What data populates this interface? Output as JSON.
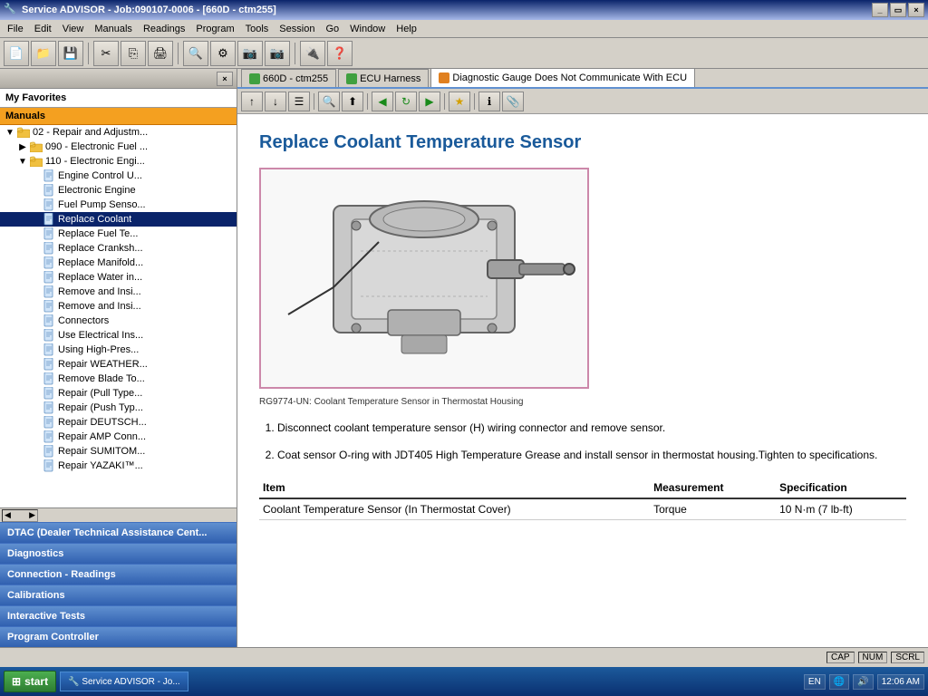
{
  "window": {
    "title": "Service ADVISOR - Job:090107-0006 - [660D - ctm255]",
    "icon": "🔧"
  },
  "menu": {
    "items": [
      "File",
      "Edit",
      "View",
      "Manuals",
      "Readings",
      "Program",
      "Tools",
      "Session",
      "Go",
      "Window",
      "Help"
    ]
  },
  "tabs": [
    {
      "label": "660D - ctm255",
      "color": "green",
      "active": false
    },
    {
      "label": "ECU Harness",
      "color": "green",
      "active": false
    },
    {
      "label": "Diagnostic Gauge Does Not Communicate With ECU",
      "color": "orange",
      "active": true
    }
  ],
  "left_panel": {
    "close_btn": "×",
    "my_favorites": "My Favorites",
    "manuals_label": "Manuals",
    "tree": [
      {
        "level": 1,
        "type": "folder",
        "label": "02 - Repair and Adjustm...",
        "expanded": true
      },
      {
        "level": 2,
        "type": "folder",
        "label": "090 - Electronic Fuel ...",
        "expanded": false
      },
      {
        "level": 2,
        "type": "folder",
        "label": "110 - Electronic Engi...",
        "expanded": true
      },
      {
        "level": 3,
        "type": "doc",
        "label": "Engine Control U..."
      },
      {
        "level": 3,
        "type": "doc",
        "label": "Electronic Engine"
      },
      {
        "level": 3,
        "type": "doc",
        "label": "Fuel Pump Senso..."
      },
      {
        "level": 3,
        "type": "doc",
        "label": "Replace Coolant",
        "selected": true
      },
      {
        "level": 3,
        "type": "doc",
        "label": "Replace Fuel Te..."
      },
      {
        "level": 3,
        "type": "doc",
        "label": "Replace Cranksh..."
      },
      {
        "level": 3,
        "type": "doc",
        "label": "Replace Manifold..."
      },
      {
        "level": 3,
        "type": "doc",
        "label": "Replace Water in..."
      },
      {
        "level": 3,
        "type": "doc",
        "label": "Remove and Insi..."
      },
      {
        "level": 3,
        "type": "doc",
        "label": "Remove and Insi..."
      },
      {
        "level": 3,
        "type": "doc",
        "label": "Connectors"
      },
      {
        "level": 3,
        "type": "doc",
        "label": "Use Electrical Ins..."
      },
      {
        "level": 3,
        "type": "doc",
        "label": "Using High-Pres..."
      },
      {
        "level": 3,
        "type": "doc",
        "label": "Repair WEATHER..."
      },
      {
        "level": 3,
        "type": "doc",
        "label": "Remove Blade To..."
      },
      {
        "level": 3,
        "type": "doc",
        "label": "Repair (Pull Type..."
      },
      {
        "level": 3,
        "type": "doc",
        "label": "Repair (Push Typ..."
      },
      {
        "level": 3,
        "type": "doc",
        "label": "Repair DEUTSCH..."
      },
      {
        "level": 3,
        "type": "doc",
        "label": "Repair AMP Conn..."
      },
      {
        "level": 3,
        "type": "doc",
        "label": "Repair SUMITOM..."
      },
      {
        "level": 3,
        "type": "doc",
        "label": "Repair YAZAKI™..."
      }
    ],
    "bottom_items": [
      "DTAC (Dealer Technical Assistance Cent...",
      "Diagnostics",
      "Connection - Readings",
      "Calibrations",
      "Interactive Tests",
      "Program Controller"
    ]
  },
  "content": {
    "title": "Replace Coolant Temperature Sensor",
    "diagram_caption": "RG9774-UN: Coolant Temperature Sensor in Thermostat Housing",
    "steps": [
      "Disconnect coolant temperature sensor (H) wiring connector and remove sensor.",
      "Coat sensor O-ring with JDT405 High Temperature Grease and install sensor in thermostat housing.Tighten to specifications."
    ],
    "table": {
      "headers": [
        "Item",
        "Measurement",
        "Specification"
      ],
      "rows": [
        [
          "Coolant Temperature Sensor (In Thermostat Cover)",
          "Torque",
          "10 N·m (7 lb-ft)"
        ]
      ]
    }
  },
  "status_bar": {
    "caps": "CAP",
    "num": "NUM",
    "scrl": "SCRL"
  },
  "taskbar": {
    "start_label": "start",
    "items": [
      "Service ADVISOR - Jo..."
    ],
    "locale": "EN",
    "time": "12:06 AM"
  },
  "toolbar_buttons": [
    "📄",
    "📁",
    "💾",
    "✂",
    "📋",
    "🖨",
    "🔍",
    "⚙",
    "📷",
    "📷",
    "🔌",
    "❓"
  ],
  "content_toolbar": [
    "↑",
    "↓",
    "☰",
    "🔍",
    "⬆",
    "◀",
    "🔄",
    "▶",
    "⭐",
    "ℹ",
    "📎"
  ],
  "icons": {
    "folder_open": "📂",
    "folder_closed": "📁",
    "document": "📄",
    "expand_open": "▼",
    "expand_closed": "▶",
    "leaf": " "
  }
}
